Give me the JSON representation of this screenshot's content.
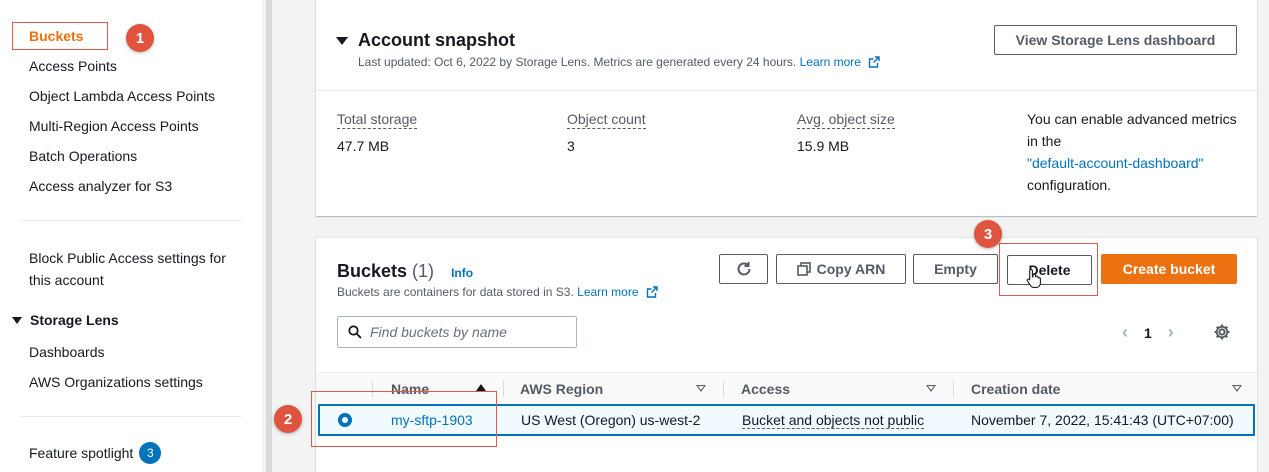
{
  "sidebar": {
    "items": [
      {
        "label": "Buckets"
      },
      {
        "label": "Access Points"
      },
      {
        "label": "Object Lambda Access Points"
      },
      {
        "label": "Multi-Region Access Points"
      },
      {
        "label": "Batch Operations"
      },
      {
        "label": "Access analyzer for S3"
      }
    ],
    "block_public_access_line1": "Block Public Access settings for",
    "block_public_access_line2": "this account",
    "storage_lens": {
      "title": "Storage Lens",
      "items": [
        {
          "label": "Dashboards"
        },
        {
          "label": "AWS Organizations settings"
        }
      ]
    },
    "feature_spotlight": {
      "label": "Feature spotlight",
      "badge": "3"
    }
  },
  "snapshot": {
    "title": "Account snapshot",
    "subtitle": "Last updated: Oct 6, 2022 by Storage Lens. Metrics are generated every 24 hours.",
    "learn_more": "Learn more",
    "dashboard_button": "View Storage Lens dashboard",
    "metrics": [
      {
        "label": "Total storage",
        "value": "47.7 MB"
      },
      {
        "label": "Object count",
        "value": "3"
      },
      {
        "label": "Avg. object size",
        "value": "15.9 MB"
      }
    ],
    "advanced_pre": "You can enable advanced metrics in the",
    "advanced_link": "\"default-account-dashboard\"",
    "advanced_post": "configuration."
  },
  "buckets": {
    "title": "Buckets",
    "count": "(1)",
    "info": "Info",
    "subtitle": "Buckets are containers for data stored in S3.",
    "learn_more": "Learn more",
    "buttons": {
      "copy_arn": "Copy ARN",
      "empty": "Empty",
      "delete": "Delete",
      "create": "Create bucket"
    },
    "search_placeholder": "Find buckets by name",
    "page": "1",
    "columns": [
      "Name",
      "AWS Region",
      "Access",
      "Creation date"
    ],
    "rows": [
      {
        "name": "my-sftp-1903",
        "region": "US West (Oregon) us-west-2",
        "access": "Bucket and objects not public",
        "created": "November 7, 2022, 15:41:43 (UTC+07:00)"
      }
    ]
  },
  "annotations": [
    "1",
    "2",
    "3"
  ],
  "colors": {
    "accent": "#ec7211",
    "link": "#0073bb",
    "annotation": "#e0533f"
  }
}
